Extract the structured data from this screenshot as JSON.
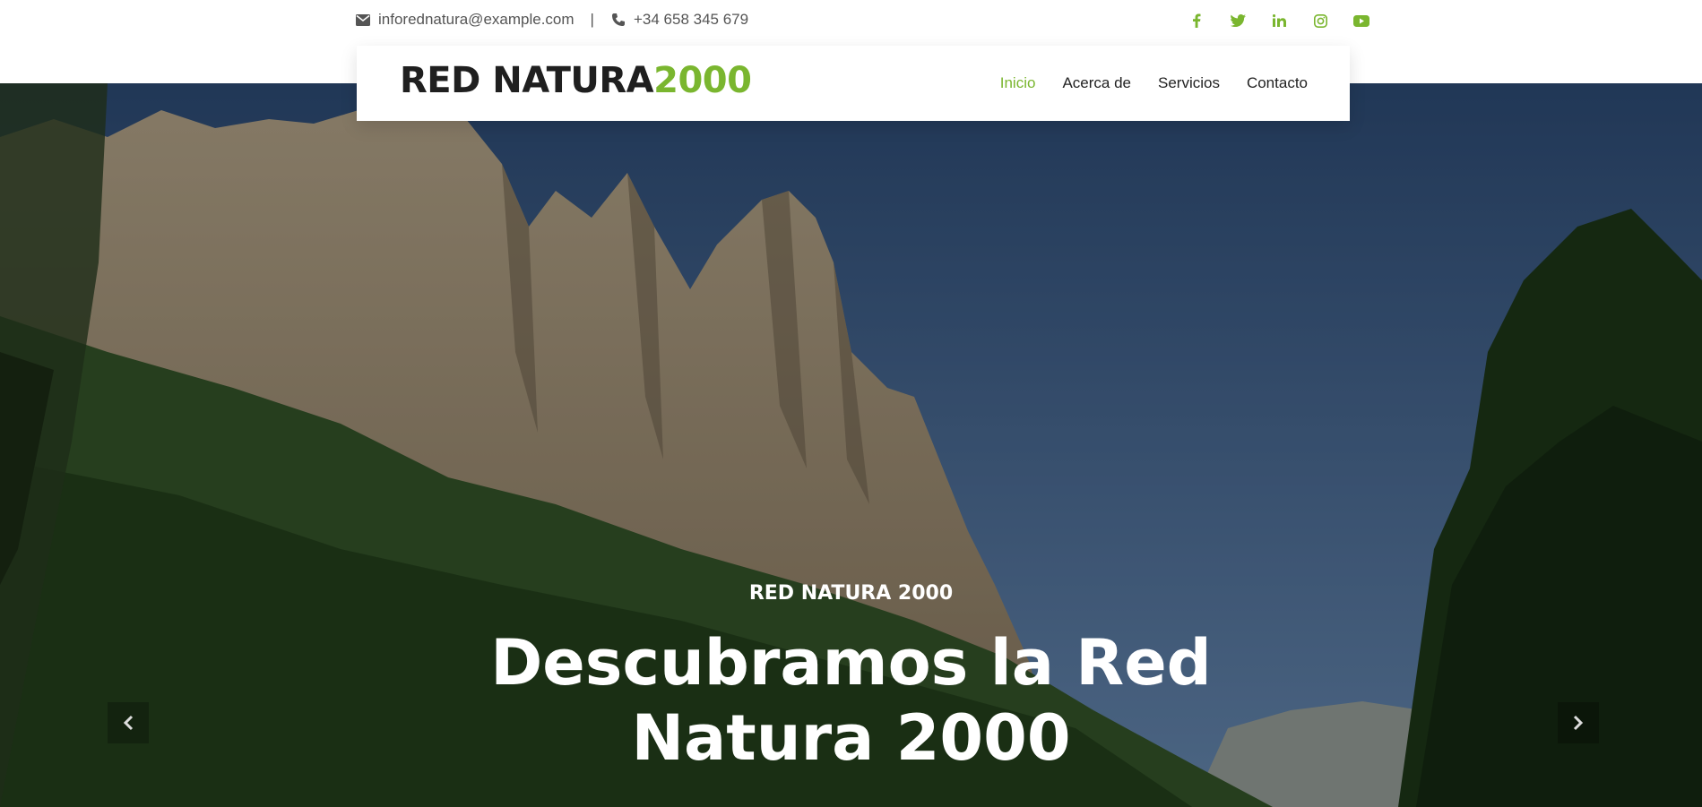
{
  "topbar": {
    "email": "inforednatura@example.com",
    "separator": "|",
    "phone": "+34 658 345 679",
    "social": [
      "facebook-icon",
      "twitter-icon",
      "linkedin-icon",
      "instagram-icon",
      "youtube-icon"
    ]
  },
  "brand": {
    "part1": "RED NATURA",
    "part2": "2000"
  },
  "nav": {
    "items": [
      "Inicio",
      "Acerca de",
      "Servicios",
      "Contacto"
    ],
    "active_index": 0
  },
  "hero": {
    "eyebrow": "RED NATURA 2000",
    "headline_line1": "Descubramos la Red",
    "headline_line2": "Natura 2000"
  },
  "colors": {
    "accent": "#7ab62f",
    "dark": "#1f1f1f",
    "muted": "#555555"
  }
}
